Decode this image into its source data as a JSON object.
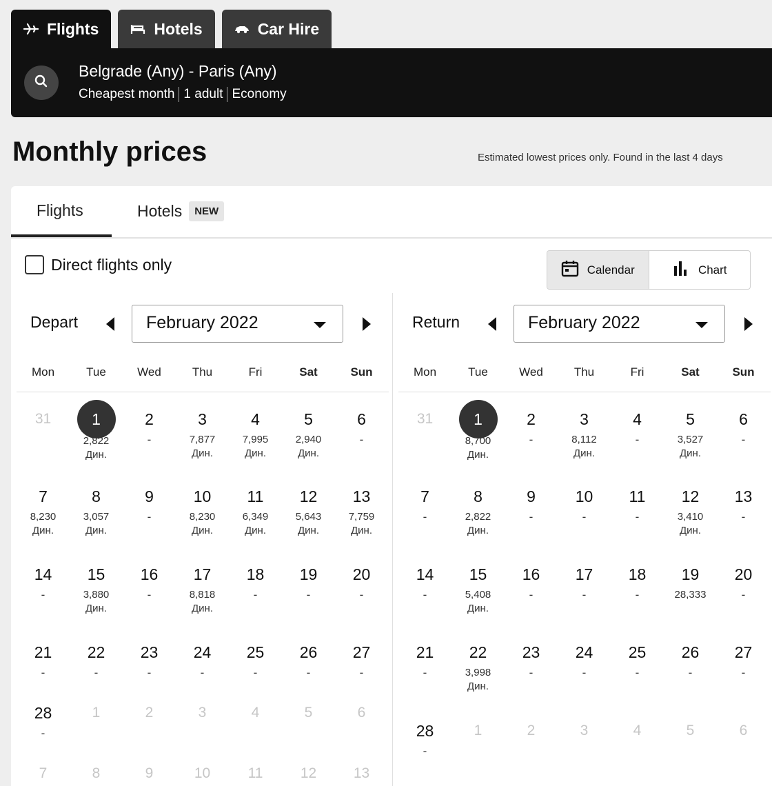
{
  "top_tabs": [
    {
      "label": "Flights",
      "icon": "plane-icon"
    },
    {
      "label": "Hotels",
      "icon": "bed-icon"
    },
    {
      "label": "Car Hire",
      "icon": "car-icon"
    }
  ],
  "search": {
    "route": "Belgrade (Any) - Paris (Any)",
    "when": "Cheapest month",
    "travellers": "1 adult",
    "cabin": "Economy"
  },
  "page_title": "Monthly prices",
  "note": "Estimated lowest prices only. Found in the last 4 days",
  "sub_tabs": {
    "flights": "Flights",
    "hotels": "Hotels",
    "badge": "NEW"
  },
  "direct_only_label": "Direct flights only",
  "view_toggle": {
    "calendar": "Calendar",
    "chart": "Chart"
  },
  "weekdays": [
    "Mon",
    "Tue",
    "Wed",
    "Thu",
    "Fri",
    "Sat",
    "Sun"
  ],
  "depart": {
    "label": "Depart",
    "month": "February 2022",
    "weeks": [
      [
        {
          "d": "31",
          "muted": true
        },
        {
          "d": "1",
          "selected": true,
          "p": "2,822",
          "c": "Дин."
        },
        {
          "d": "2",
          "dash": true
        },
        {
          "d": "3",
          "p": "7,877",
          "c": "Дин."
        },
        {
          "d": "4",
          "p": "7,995",
          "c": "Дин."
        },
        {
          "d": "5",
          "p": "2,940",
          "c": "Дин."
        },
        {
          "d": "6",
          "dash": true
        }
      ],
      [
        {
          "d": "7",
          "p": "8,230",
          "c": "Дин."
        },
        {
          "d": "8",
          "p": "3,057",
          "c": "Дин."
        },
        {
          "d": "9",
          "dash": true
        },
        {
          "d": "10",
          "p": "8,230",
          "c": "Дин."
        },
        {
          "d": "11",
          "p": "6,349",
          "c": "Дин."
        },
        {
          "d": "12",
          "p": "5,643",
          "c": "Дин."
        },
        {
          "d": "13",
          "p": "7,759",
          "c": "Дин."
        }
      ],
      [
        {
          "d": "14",
          "dash": true
        },
        {
          "d": "15",
          "p": "3,880",
          "c": "Дин."
        },
        {
          "d": "16",
          "dash": true
        },
        {
          "d": "17",
          "p": "8,818",
          "c": "Дин."
        },
        {
          "d": "18",
          "dash": true
        },
        {
          "d": "19",
          "dash": true
        },
        {
          "d": "20",
          "dash": true
        }
      ],
      [
        {
          "d": "21",
          "dash": true
        },
        {
          "d": "22",
          "dash": true
        },
        {
          "d": "23",
          "dash": true
        },
        {
          "d": "24",
          "dash": true
        },
        {
          "d": "25",
          "dash": true
        },
        {
          "d": "26",
          "dash": true
        },
        {
          "d": "27",
          "dash": true
        }
      ],
      [
        {
          "d": "28",
          "dash": true
        },
        {
          "d": "1",
          "muted": true
        },
        {
          "d": "2",
          "muted": true
        },
        {
          "d": "3",
          "muted": true
        },
        {
          "d": "4",
          "muted": true
        },
        {
          "d": "5",
          "muted": true
        },
        {
          "d": "6",
          "muted": true
        }
      ],
      [
        {
          "d": "7",
          "muted": true
        },
        {
          "d": "8",
          "muted": true
        },
        {
          "d": "9",
          "muted": true
        },
        {
          "d": "10",
          "muted": true
        },
        {
          "d": "11",
          "muted": true
        },
        {
          "d": "12",
          "muted": true
        },
        {
          "d": "13",
          "muted": true
        }
      ]
    ]
  },
  "return": {
    "label": "Return",
    "month": "February 2022",
    "weeks": [
      [
        {
          "d": "31",
          "muted": true
        },
        {
          "d": "1",
          "selected": true,
          "p": "8,700",
          "c": "Дин."
        },
        {
          "d": "2",
          "dash": true
        },
        {
          "d": "3",
          "p": "8,112",
          "c": "Дин."
        },
        {
          "d": "4",
          "dash": true
        },
        {
          "d": "5",
          "p": "3,527",
          "c": "Дин."
        },
        {
          "d": "6",
          "dash": true
        }
      ],
      [
        {
          "d": "7",
          "dash": true
        },
        {
          "d": "8",
          "p": "2,822",
          "c": "Дин."
        },
        {
          "d": "9",
          "dash": true
        },
        {
          "d": "10",
          "dash": true
        },
        {
          "d": "11",
          "dash": true
        },
        {
          "d": "12",
          "p": "3,410",
          "c": "Дин."
        },
        {
          "d": "13",
          "dash": true
        }
      ],
      [
        {
          "d": "14",
          "dash": true
        },
        {
          "d": "15",
          "p": "5,408",
          "c": "Дин."
        },
        {
          "d": "16",
          "dash": true
        },
        {
          "d": "17",
          "dash": true
        },
        {
          "d": "18",
          "dash": true
        },
        {
          "d": "19",
          "p": "28,333"
        },
        {
          "d": "20",
          "dash": true
        }
      ],
      [
        {
          "d": "21",
          "dash": true
        },
        {
          "d": "22",
          "p": "3,998",
          "c": "Дин."
        },
        {
          "d": "23",
          "dash": true
        },
        {
          "d": "24",
          "dash": true
        },
        {
          "d": "25",
          "dash": true
        },
        {
          "d": "26",
          "dash": true
        },
        {
          "d": "27",
          "dash": true
        }
      ],
      [
        {
          "d": "28",
          "dash": true
        },
        {
          "d": "1",
          "muted": true
        },
        {
          "d": "2",
          "muted": true
        },
        {
          "d": "3",
          "muted": true
        },
        {
          "d": "4",
          "muted": true
        },
        {
          "d": "5",
          "muted": true
        },
        {
          "d": "6",
          "muted": true
        }
      ]
    ]
  }
}
